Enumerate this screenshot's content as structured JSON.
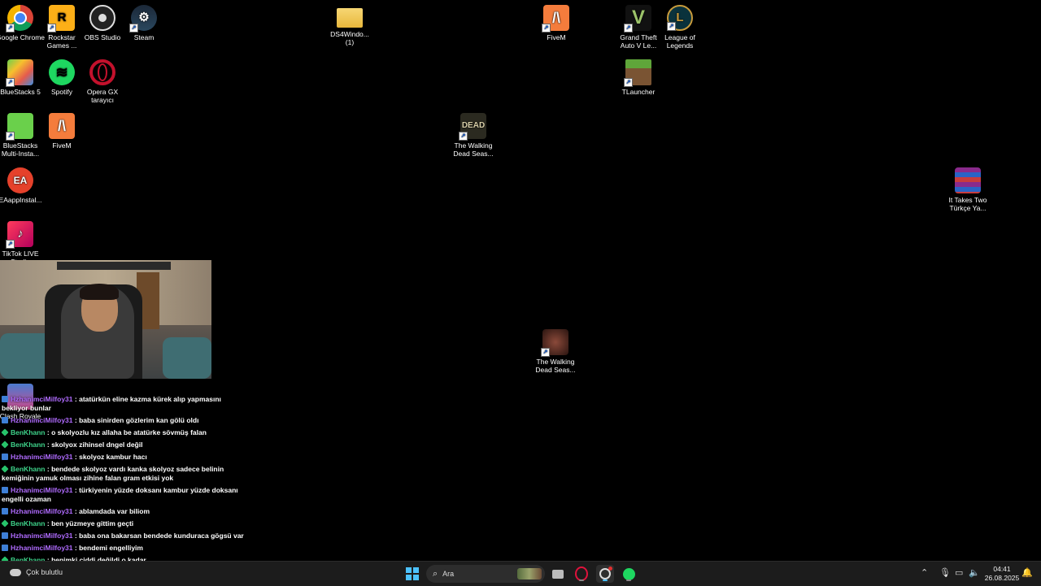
{
  "desktop_icons": [
    {
      "label": "Google Chrome",
      "icon": "chrome-icon"
    },
    {
      "label": "Rockstar Games ...",
      "icon": "rockstar-icon"
    },
    {
      "label": "OBS Studio",
      "icon": "obs-icon"
    },
    {
      "label": "Steam",
      "icon": "steam-icon"
    },
    {
      "label": "DS4Windo... (1)",
      "icon": "folder-icon"
    },
    {
      "label": "FiveM",
      "icon": "fivem-icon"
    },
    {
      "label": "Grand Theft Auto V Le...",
      "icon": "gta-icon"
    },
    {
      "label": "League of Legends",
      "icon": "lol-icon"
    },
    {
      "label": "BlueStacks 5",
      "icon": "bluestacks-icon"
    },
    {
      "label": "Spotify",
      "icon": "spotify-icon"
    },
    {
      "label": "Opera GX tarayıcı",
      "icon": "opera-icon"
    },
    {
      "label": "TLauncher",
      "icon": "tlauncher-icon"
    },
    {
      "label": "BlueStacks Multi-Insta...",
      "icon": "bluestacks-multi-icon"
    },
    {
      "label": "FiveM",
      "icon": "fivem-icon"
    },
    {
      "label": "The Walking Dead Seas...",
      "icon": "walking-dead-icon"
    },
    {
      "label": "EAappInstal...",
      "icon": "ea-icon"
    },
    {
      "label": "It Takes Two Türkçe Ya...",
      "icon": "winrar-icon"
    },
    {
      "label": "TikTok LIVE Studio",
      "icon": "tiktok-icon"
    },
    {
      "label": "The Walking Dead Seas...",
      "icon": "walking-dead-icon"
    },
    {
      "label": "Clash Royale",
      "icon": "clash-royale-icon"
    }
  ],
  "chat": {
    "messages": [
      {
        "user": "HzhanimciMilfoy31",
        "text": "atatürkün eline kazma kürek alıp yapmasını bekliyor bunlar",
        "badge": "vip"
      },
      {
        "user": "HzhanimciMilfoy31",
        "text": "baba sinirden gözlerim kan gölü oldı",
        "badge": "vip"
      },
      {
        "user": "BenKhann",
        "text": "o skolyozlu kız allaha be atatürke sövmüş falan",
        "badge": "sub"
      },
      {
        "user": "BenKhann",
        "text": "skolyox zihinsel dngel değil",
        "badge": "sub"
      },
      {
        "user": "HzhanimciMilfoy31",
        "text": "skolyoz kambur hacı",
        "badge": "vip"
      },
      {
        "user": "BenKhann",
        "text": "bendede skolyoz vardı kanka skolyoz sadece belinin kemiğinin yamuk olması zihine falan gram etkisi yok",
        "badge": "sub"
      },
      {
        "user": "HzhanimciMilfoy31",
        "text": "türkiyenin yüzde doksanı kambur yüzde doksanı engelli ozaman",
        "badge": "vip"
      },
      {
        "user": "HzhanimciMilfoy31",
        "text": "ablamdada var biliom",
        "badge": "vip"
      },
      {
        "user": "BenKhann",
        "text": "ben yüzmeye gittim geçti",
        "badge": "sub"
      },
      {
        "user": "HzhanimciMilfoy31",
        "text": "baba ona bakarsan bendede kunduraca gögsü var",
        "badge": "vip"
      },
      {
        "user": "HzhanimciMilfoy31",
        "text": "bendemi engelliyim",
        "badge": "vip"
      },
      {
        "user": "BenKhann",
        "text": "benimki ciddi değildi o kadar",
        "badge": "sub"
      }
    ],
    "separator": " : "
  },
  "taskbar": {
    "weather": "Çok bulutlu",
    "search_placeholder": "Ara",
    "time": "04:41",
    "date": "26.08.2025",
    "start_icon": "windows-icon",
    "pinned": [
      "file-explorer-icon",
      "opera-gx-icon",
      "obs-icon",
      "spotify-icon"
    ],
    "tray": [
      "chevron-up-icon",
      "microphone-icon",
      "network-icon",
      "volume-icon",
      "notification-icon"
    ]
  }
}
